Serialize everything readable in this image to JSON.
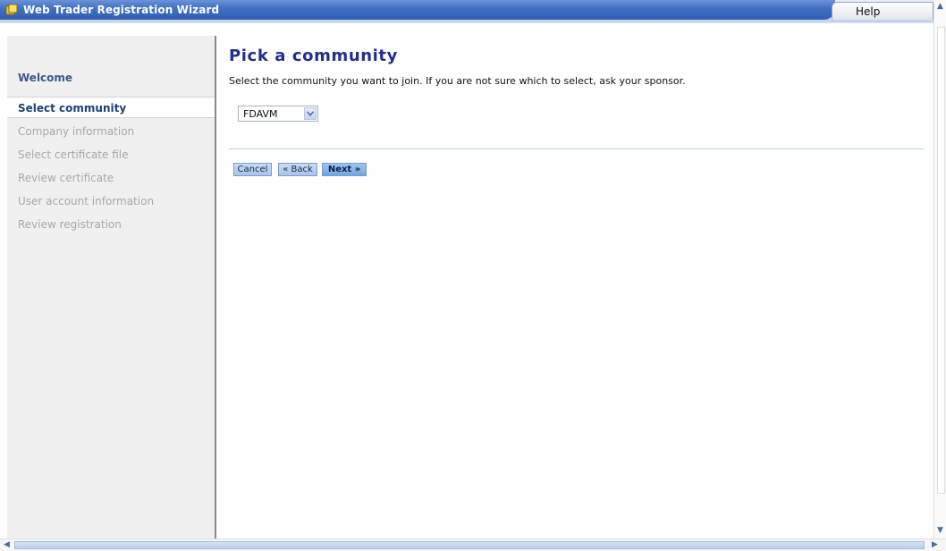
{
  "window": {
    "title": "Web Trader Registration Wizard",
    "help_label": "Help",
    "icon": "app-window-icon"
  },
  "sidebar": {
    "items": [
      {
        "label": "Welcome",
        "state": "completed"
      },
      {
        "label": "Select community",
        "state": "current"
      },
      {
        "label": "Company information",
        "state": "disabled"
      },
      {
        "label": "Select certificate file",
        "state": "disabled"
      },
      {
        "label": "Review certificate",
        "state": "disabled"
      },
      {
        "label": "User account information",
        "state": "disabled"
      },
      {
        "label": "Review registration",
        "state": "disabled"
      }
    ]
  },
  "main": {
    "heading": "Pick a community",
    "description": "Select the community you want to join. If you are not sure which to select, ask your sponsor.",
    "community_select": {
      "value": "FDAVM"
    },
    "buttons": {
      "cancel": "Cancel",
      "back": "« Back",
      "next": "Next »"
    }
  },
  "colors": {
    "titlebar": "#3f6fc2",
    "heading": "#232d8c",
    "selected_nav_text": "#1e3f78",
    "disabled_nav_text": "#a8a8a8"
  }
}
